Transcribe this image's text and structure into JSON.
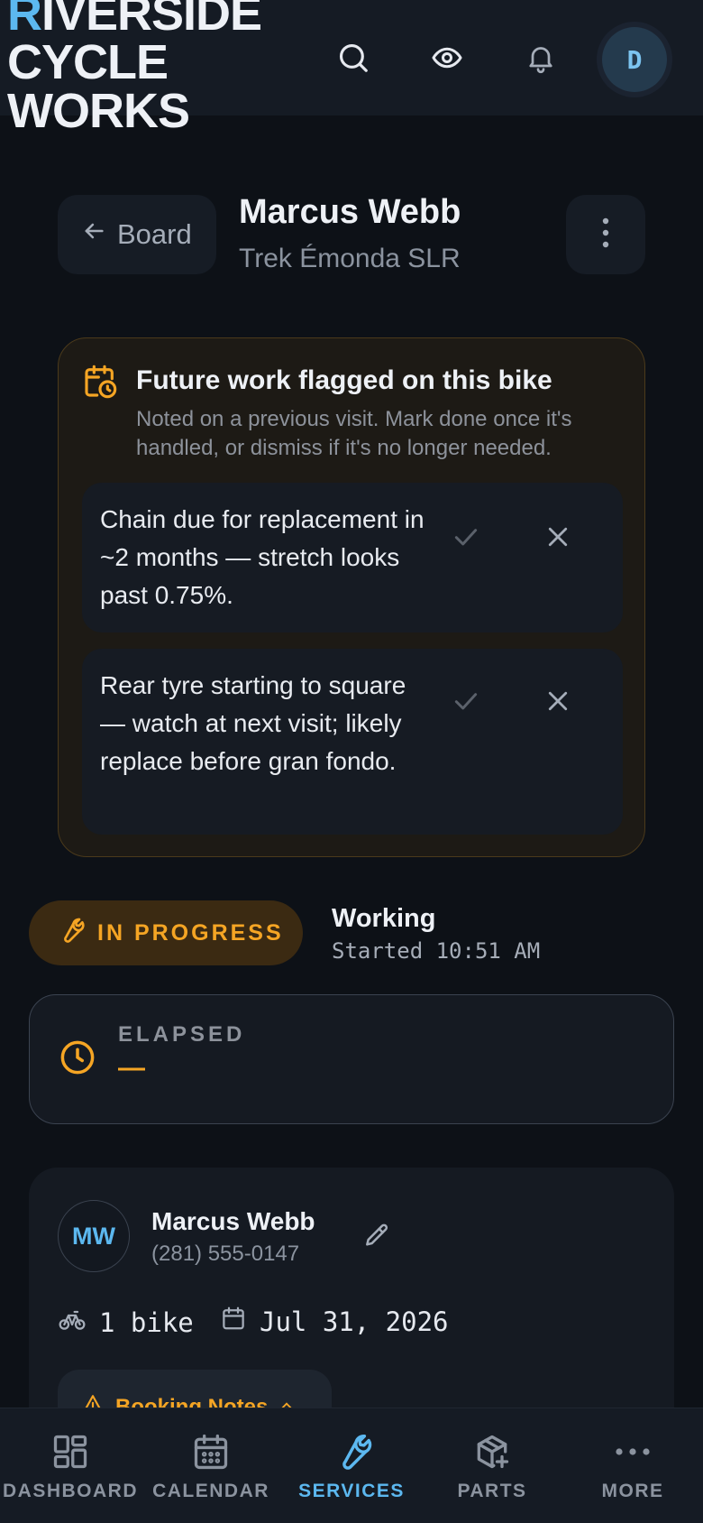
{
  "header": {
    "brand_first_letter": "R",
    "brand_rest_line1": "IVERSIDE",
    "brand_line2": "CYCLE",
    "brand_line3": "WORKS",
    "avatar_initial": "D",
    "icons": [
      "search-icon",
      "eye-icon",
      "bell-icon"
    ]
  },
  "title_row": {
    "back_label": "Board",
    "customer_name": "Marcus Webb",
    "bike": "Trek Émonda SLR"
  },
  "flag_card": {
    "title": "Future work flagged on this bike",
    "subtitle": "Noted on a previous visit. Mark done once it's handled, or dismiss if it's no longer needed.",
    "items": [
      {
        "text": "Chain due for replacement in ~2 months — stretch looks past 0.75%."
      },
      {
        "text": "Rear tyre starting to square — watch at next visit; likely replace before gran fondo."
      }
    ]
  },
  "status": {
    "pill_label": "IN PROGRESS",
    "title": "Working",
    "started": "Started 10:51 AM"
  },
  "elapsed": {
    "label": "ELAPSED",
    "value": "—"
  },
  "customer_card": {
    "initials": "MW",
    "name": "Marcus Webb",
    "phone": "(281) 555-0147",
    "bikes": "1 bike",
    "date": "Jul 31, 2026",
    "booking_notes_label": "Booking Notes"
  },
  "bottom_nav": {
    "items": [
      {
        "label": "DASHBOARD"
      },
      {
        "label": "CALENDAR"
      },
      {
        "label": "SERVICES"
      },
      {
        "label": "PARTS"
      },
      {
        "label": "MORE"
      }
    ],
    "active": "SERVICES"
  },
  "colors": {
    "accent_blue": "#5cb8f0",
    "accent_orange": "#f5a524",
    "background": "#0d1117"
  }
}
